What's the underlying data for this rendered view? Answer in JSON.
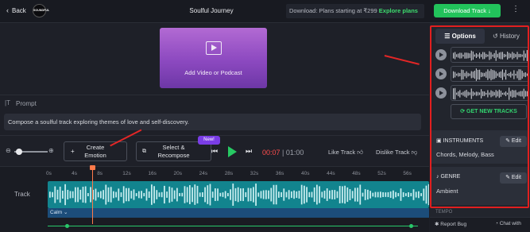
{
  "header": {
    "back_label": "Back",
    "logo_text": "SOUNDFUL",
    "title": "Soulful Journey",
    "promo_text": "Download: Plans starting at ₹299",
    "promo_link": "Explore plans",
    "download_label": "Download Track",
    "more_icon": "vertical-dots-icon"
  },
  "video": {
    "label": "Add Video or Podcast"
  },
  "prompt": {
    "heading": "Prompt",
    "text": "Compose a soulful track exploring themes of love and self-discovery."
  },
  "toolbar": {
    "zoom_out_icon": "zoom-out-icon",
    "zoom_level": 0.15,
    "zoom_in_icon": "zoom-in-icon",
    "create_emotion_line1": "Create",
    "create_emotion_line2": "Emotion",
    "select_recompose_line1": "Select &",
    "select_recompose_line2": "Recompose",
    "new_badge": "New!",
    "time_current": "00:07",
    "time_separator": "|",
    "time_total": "01:00",
    "like_label": "Like Track",
    "dislike_label": "Dislike Track"
  },
  "timeline": {
    "ticks": [
      "0s",
      "4s",
      "8s",
      "12s",
      "16s",
      "20s",
      "24s",
      "28s",
      "32s",
      "36s",
      "40s",
      "44s",
      "48s",
      "52s",
      "56s"
    ],
    "track_label": "Track",
    "emotion_label": "Calm",
    "playhead_seconds": 7
  },
  "side": {
    "tab_options": "Options",
    "tab_history": "History",
    "get_new_tracks": "GET NEW TRACKS",
    "instruments_title": "INSTRUMENTS",
    "instruments_value": "Chords, Melody, Bass",
    "genre_title": "GENRE",
    "genre_value": "Ambient",
    "edit_label": "Edit",
    "tempo_title": "TEMPO",
    "report_bug": "Report Bug",
    "chat": "Chat with",
    "colors": {
      "highlight": "#e11f1f",
      "accent_green": "#22c35b"
    }
  }
}
